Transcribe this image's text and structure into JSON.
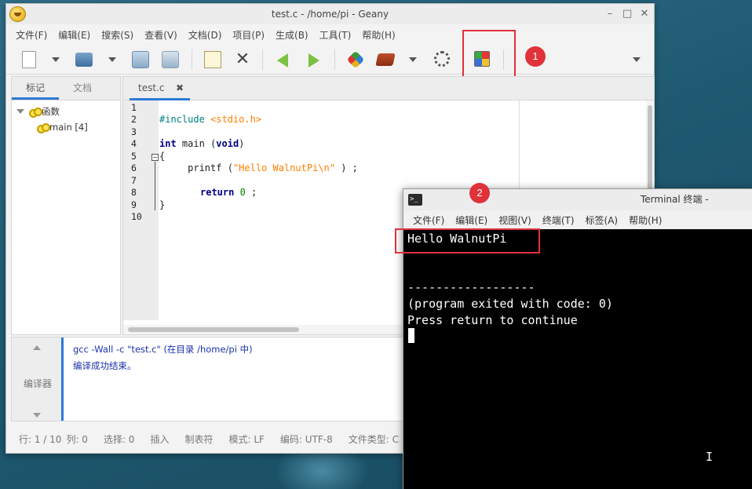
{
  "geany": {
    "title": "test.c - /home/pi - Geany",
    "window_buttons": [
      "–",
      "□",
      "✕"
    ],
    "menu": [
      "文件(F)",
      "编辑(E)",
      "搜索(S)",
      "查看(V)",
      "文档(D)",
      "项目(P)",
      "生成(B)",
      "工具(T)",
      "帮助(H)"
    ],
    "sidebar_tabs": [
      "标记",
      "文档"
    ],
    "tree": {
      "group": "函数",
      "item": "main [4]"
    },
    "editor_tab": "test.c",
    "line_numbers": [
      "1",
      "2",
      "3",
      "4",
      "5",
      "6",
      "7",
      "8",
      "9",
      "10"
    ],
    "code": {
      "l2": "#include ",
      "l2_header": "<stdio.h>",
      "l4_type": "int",
      "l4_mid": " main (",
      "l4_void": "void",
      "l4_end": ")",
      "l5": "{",
      "l6_pre": "     printf (",
      "l6_str": "\"Hello WalnutPi\\n\"",
      "l6_post": ") ;",
      "l8_kw": "return",
      "l8_num": "0",
      "l8_end": " ;",
      "l9": "}"
    },
    "compiler_panel_label": "编译器",
    "compiler_messages": [
      "gcc -Wall -c \"test.c\" (在目录 /home/pi 中)",
      "编译成功结束。"
    ],
    "status": [
      "行: 1 / 10",
      "列: 0",
      "选择: 0",
      "插入",
      "制表符",
      "模式: LF",
      "编码: UTF-8",
      "文件类型: C"
    ]
  },
  "annotations": {
    "one": "1",
    "two": "2"
  },
  "terminal": {
    "title": "Terminal 终端 -",
    "icon": ">_",
    "menu": [
      "文件(F)",
      "编辑(E)",
      "视图(V)",
      "终端(T)",
      "标签(A)",
      "帮助(H)"
    ],
    "lines": [
      "Hello WalnutPi",
      "",
      "",
      "------------------",
      "(program exited with code: 0)",
      "Press return to continue"
    ]
  },
  "icons": [
    "app-icon",
    "new-file-icon",
    "open-file-icon",
    "save-icon",
    "save-all-icon",
    "revert-icon",
    "close-icon",
    "back-icon",
    "forward-icon",
    "compile-icon",
    "build-icon",
    "execute-icon",
    "color-chooser-icon",
    "terminal-icon",
    "mouse-ibeam-icon"
  ],
  "colors": {
    "annotation_red": "#e0323a",
    "tab_accent": "#2a7ad6",
    "compiler_text": "#1a33a8"
  }
}
